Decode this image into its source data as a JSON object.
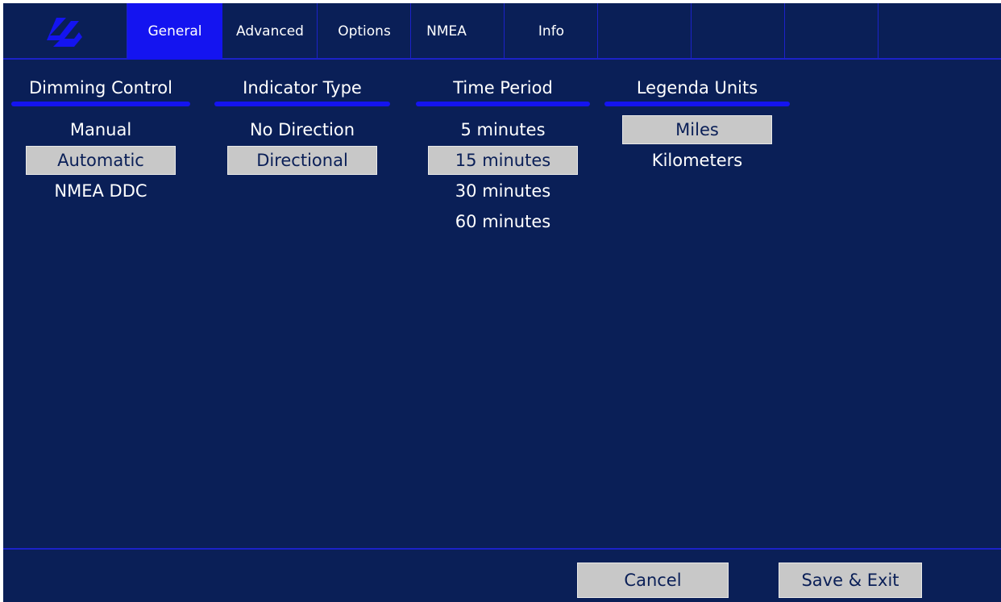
{
  "tabs": [
    {
      "label": "General",
      "active": true
    },
    {
      "label": "Advanced",
      "active": false
    },
    {
      "label": "Options",
      "active": false
    },
    {
      "label": "NMEA",
      "active": false
    },
    {
      "label": "Info",
      "active": false
    }
  ],
  "logo": {
    "icon": "brand-logo-icon",
    "color": "#1414f0"
  },
  "columns": [
    {
      "title": "Dimming Control",
      "options": [
        "Manual",
        "Automatic",
        "NMEA DDC"
      ],
      "selected": "Automatic"
    },
    {
      "title": "Indicator Type",
      "options": [
        "No Direction",
        "Directional"
      ],
      "selected": "Directional"
    },
    {
      "title": "Time Period",
      "options": [
        "5 minutes",
        "15 minutes",
        "30 minutes",
        "60 minutes"
      ],
      "selected": "15 minutes"
    },
    {
      "title": "Legenda Units",
      "options": [
        "Miles",
        "Kilometers"
      ],
      "selected": "Miles"
    }
  ],
  "footer": {
    "cancel_label": "Cancel",
    "save_label": "Save & Exit"
  },
  "colors": {
    "background": "#0a1f57",
    "accent": "#1414f0",
    "selected_bg": "#c8c8c8"
  }
}
